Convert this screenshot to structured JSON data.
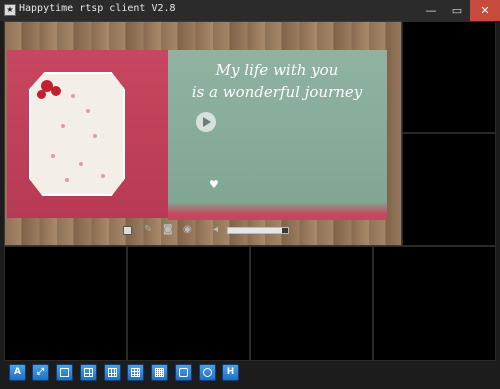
{
  "window": {
    "title": "Happytime rtsp client V2.8",
    "controls": {
      "minimize": "—",
      "maximize": "▭",
      "close": "✕"
    }
  },
  "video": {
    "overlay_lines": [
      "My life with you",
      "is a wonderful journey"
    ],
    "controls": {
      "stop": "stop-icon",
      "mute": "microphone-icon",
      "snapshot": "camera-icon",
      "record": "record-icon",
      "volume": "speaker-icon",
      "volume_level": 0.9
    }
  },
  "toolbar": {
    "buttons": [
      {
        "id": "audio",
        "glyph": "A",
        "icon": "audio-icon"
      },
      {
        "id": "fullscreen",
        "glyph": "⤢",
        "icon": "fullscreen-icon"
      },
      {
        "id": "layout1",
        "glyph": "",
        "icon": "layout-1-icon"
      },
      {
        "id": "layout4",
        "glyph": "",
        "icon": "layout-4-icon"
      },
      {
        "id": "layout6",
        "glyph": "",
        "icon": "layout-6-icon"
      },
      {
        "id": "layout9",
        "glyph": "",
        "icon": "layout-9-icon"
      },
      {
        "id": "layout16",
        "glyph": "",
        "icon": "layout-16-icon"
      },
      {
        "id": "settings",
        "glyph": "",
        "icon": "settings-icon"
      },
      {
        "id": "cloud",
        "glyph": "",
        "icon": "cloud-icon"
      },
      {
        "id": "help",
        "glyph": "H",
        "icon": "help-icon"
      }
    ]
  },
  "colors": {
    "accent": "#2f86d6",
    "close_button": "#c74b3c",
    "background": "#000000"
  }
}
